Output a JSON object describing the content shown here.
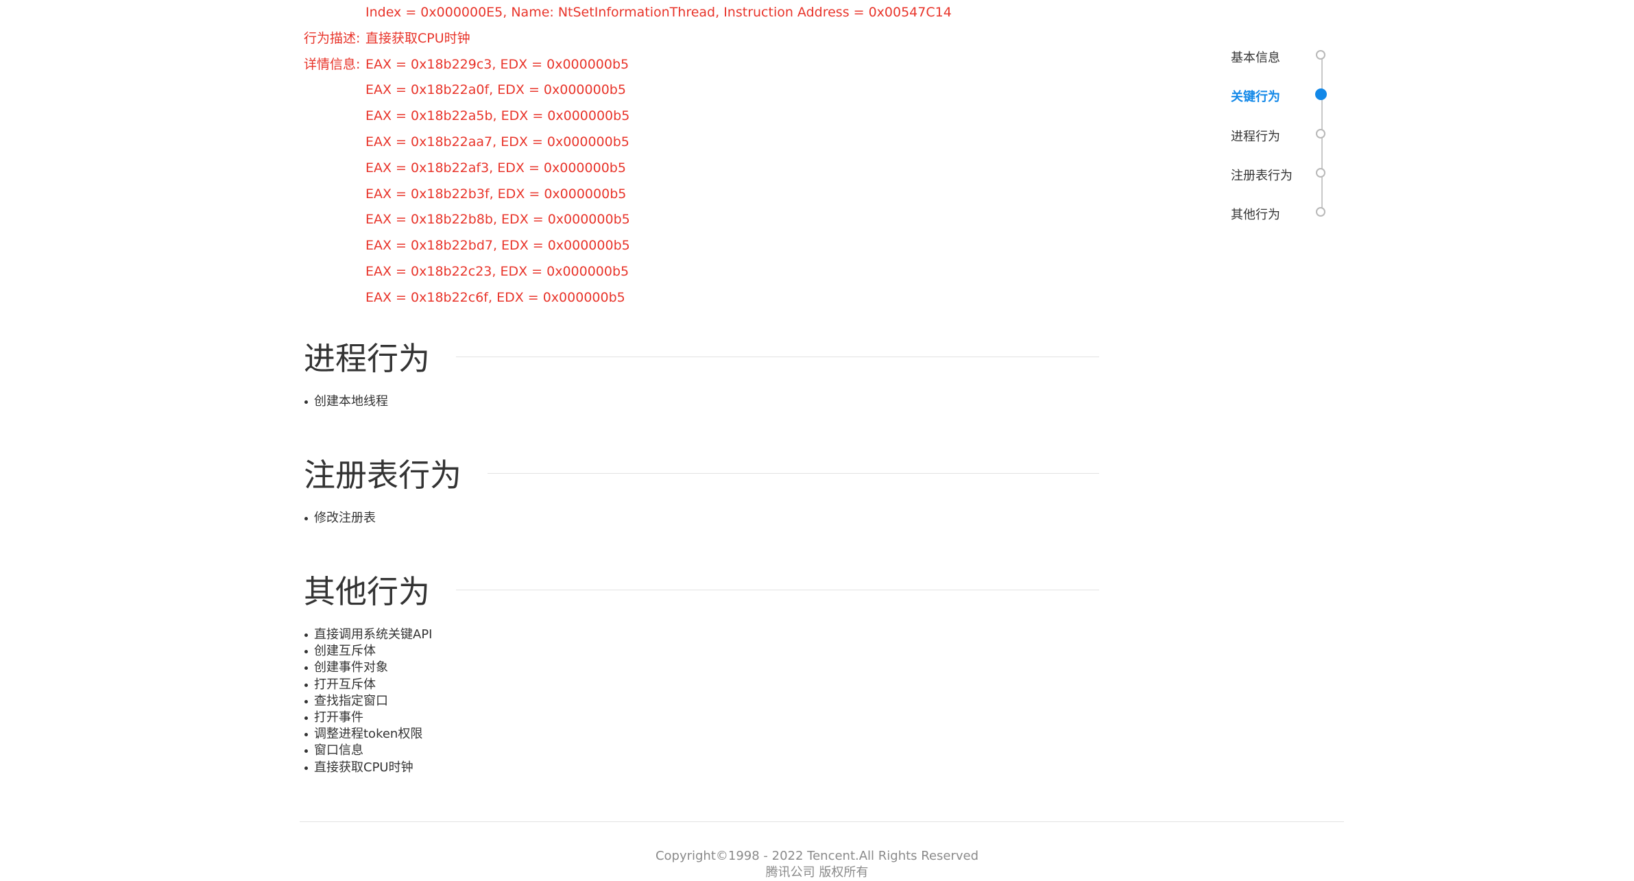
{
  "key_behavior": {
    "top_value": "Index = 0x000000E5, Name: NtSetInformationThread, Instruction Address = 0x00547C14",
    "desc_label": "行为描述:",
    "desc_value": "直接获取CPU时钟",
    "detail_label": "详情信息:",
    "details": [
      "EAX = 0x18b229c3, EDX = 0x000000b5",
      "EAX = 0x18b22a0f, EDX = 0x000000b5",
      "EAX = 0x18b22a5b, EDX = 0x000000b5",
      "EAX = 0x18b22aa7, EDX = 0x000000b5",
      "EAX = 0x18b22af3, EDX = 0x000000b5",
      "EAX = 0x18b22b3f, EDX = 0x000000b5",
      "EAX = 0x18b22b8b, EDX = 0x000000b5",
      "EAX = 0x18b22bd7, EDX = 0x000000b5",
      "EAX = 0x18b22c23, EDX = 0x000000b5",
      "EAX = 0x18b22c6f, EDX = 0x000000b5"
    ]
  },
  "process_section": {
    "title": "进程行为",
    "items": [
      "创建本地线程"
    ]
  },
  "registry_section": {
    "title": "注册表行为",
    "items": [
      "修改注册表"
    ]
  },
  "other_section": {
    "title": "其他行为",
    "items": [
      "直接调用系统关键API",
      "创建互斥体",
      "创建事件对象",
      "打开互斥体",
      "查找指定窗口",
      "打开事件",
      "调整进程token权限",
      "窗口信息",
      "直接获取CPU时钟"
    ]
  },
  "nav": {
    "items": [
      {
        "label": "基本信息",
        "active": false
      },
      {
        "label": "关键行为",
        "active": true
      },
      {
        "label": "进程行为",
        "active": false
      },
      {
        "label": "注册表行为",
        "active": false
      },
      {
        "label": "其他行为",
        "active": false
      }
    ],
    "active_color": "#1288e8"
  },
  "footer": {
    "copyright": "Copyright©1998 - 2022 Tencent.All Rights Reserved",
    "company": "腾讯公司 版权所有"
  },
  "colors": {
    "alert_text": "#e8342a",
    "heading_text": "#333333",
    "footer_text": "#8a8a8a"
  }
}
